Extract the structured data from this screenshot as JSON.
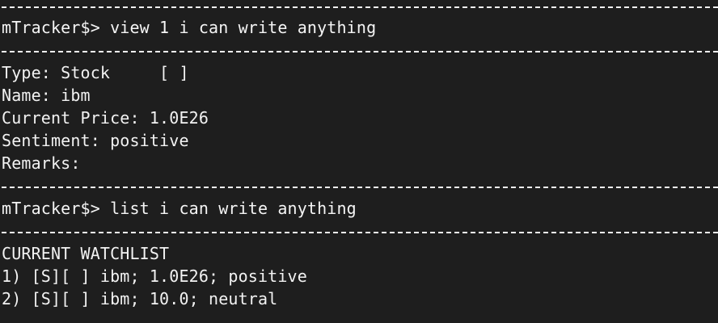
{
  "terminal": {
    "block1": {
      "prompt": "mTracker$> view 1 i can write anything"
    },
    "view": {
      "type_line": "Type: Stock     [ ]",
      "name_line": "Name: ibm",
      "price_line": "Current Price: 1.0E26",
      "sentiment_line": "Sentiment: positive",
      "remarks_line": "Remarks:"
    },
    "block2": {
      "prompt": "mTracker$> list i can write anything"
    },
    "watchlist": {
      "header": "CURRENT WATCHLIST",
      "items": [
        "1) [S][ ] ibm; 1.0E26; positive",
        "2) [S][ ] ibm; 10.0; neutral"
      ]
    }
  }
}
